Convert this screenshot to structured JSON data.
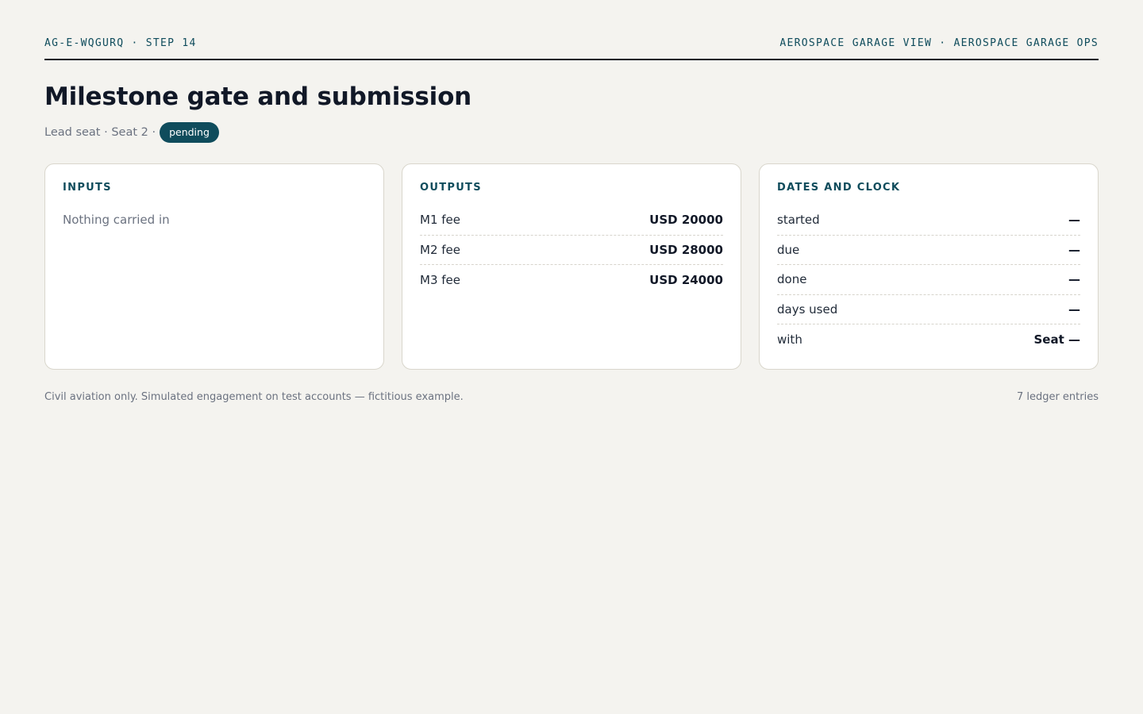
{
  "header": {
    "left_crumb": "AG-E-WQGURQ · STEP 14",
    "right_crumb": "AEROSPACE GARAGE VIEW · AEROSPACE GARAGE OPS"
  },
  "title": "Milestone gate and submission",
  "subtitle": {
    "text": "Lead seat · Seat 2 ·",
    "status": "pending"
  },
  "colors": {
    "accent": "#0f4c5c",
    "background": "#f4f3ef",
    "text": "#111827",
    "muted": "#6b7280"
  },
  "inputs": {
    "title": "INPUTS",
    "empty_text": "Nothing carried in"
  },
  "outputs": {
    "title": "OUTPUTS",
    "rows": [
      {
        "label": "M1 fee",
        "value": "USD 20000"
      },
      {
        "label": "M2 fee",
        "value": "USD 28000"
      },
      {
        "label": "M3 fee",
        "value": "USD 24000"
      }
    ]
  },
  "dates": {
    "title": "DATES AND CLOCK",
    "rows": [
      {
        "label": "started",
        "value": "—"
      },
      {
        "label": "due",
        "value": "—"
      },
      {
        "label": "done",
        "value": "—"
      },
      {
        "label": "days used",
        "value": "—"
      },
      {
        "label": "with",
        "value": "Seat —"
      }
    ]
  },
  "footer": {
    "disclaimer": "Civil aviation only. Simulated engagement on test accounts — fictitious example.",
    "ledger_count": "7 ledger entries"
  }
}
